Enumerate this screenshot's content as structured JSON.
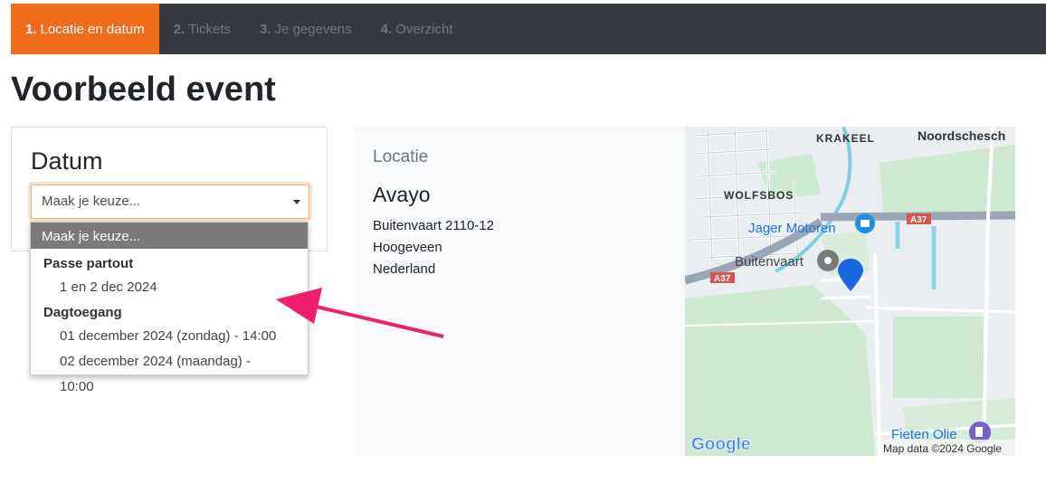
{
  "steps": [
    {
      "num": "1.",
      "label": "Locatie en datum",
      "active": true
    },
    {
      "num": "2.",
      "label": "Tickets",
      "active": false
    },
    {
      "num": "3.",
      "label": "Je gegevens",
      "active": false
    },
    {
      "num": "4.",
      "label": "Overzicht",
      "active": false
    }
  ],
  "page": {
    "title": "Voorbeeld event"
  },
  "datum": {
    "heading": "Datum",
    "select_value": "Maak je keuze...",
    "dropdown": {
      "selected": "Maak je keuze...",
      "groups": [
        {
          "label": "Passe partout",
          "options": [
            "1 en 2 dec 2024"
          ]
        },
        {
          "label": "Dagtoegang",
          "options": [
            "01 december 2024 (zondag) - 14:00",
            "02 december 2024 (maandag) - 10:00"
          ]
        }
      ]
    }
  },
  "location": {
    "label": "Locatie",
    "name": "Avayo",
    "address": [
      "Buitenvaart 2110-12",
      "Hoogeveen",
      "Nederland"
    ]
  },
  "map": {
    "labels": {
      "krakeel": "KRAKEEL",
      "noordscheschut": "Noordschesch",
      "wolfsbos": "WOLFSBOS",
      "jager_motoren": "Jager Motoren",
      "buitenvaart": "Buitenvaart",
      "a37_top": "A37",
      "a37_left": "A37",
      "fieten_olie": "Fieten Olie"
    },
    "brand": "Google",
    "attribution": "Map data ©2024 Google"
  },
  "colors": {
    "accent": "#ee6c1a",
    "nav_bg": "#343a40",
    "arrow": "#ee1f6c",
    "pin": "#1a66e0"
  }
}
